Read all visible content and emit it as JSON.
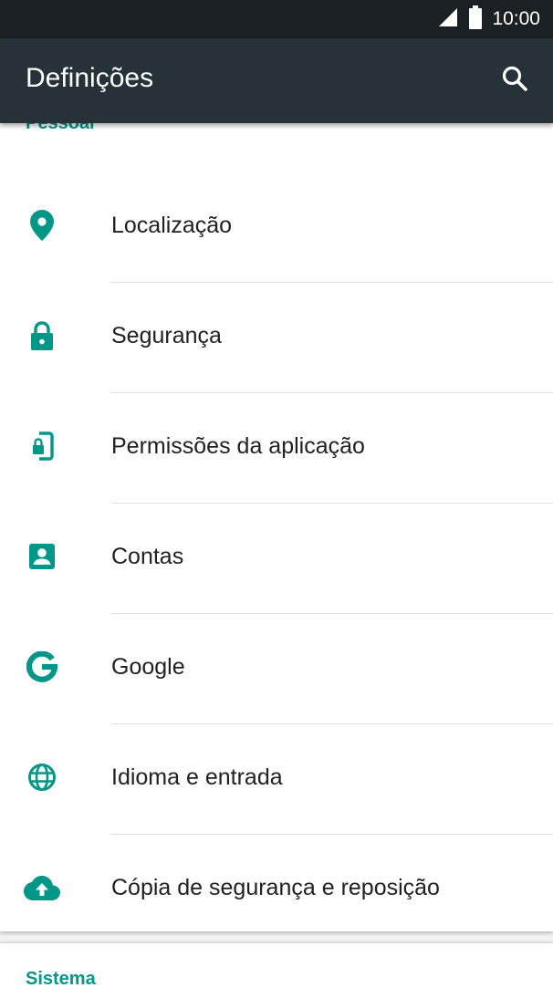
{
  "status_bar": {
    "time": "10:00",
    "icons": [
      "signal-icon",
      "battery-icon"
    ]
  },
  "app_bar": {
    "title": "Definições",
    "search_icon": "search-icon"
  },
  "sections": [
    {
      "header": "Pessoal",
      "items": [
        {
          "label": "Localização",
          "icon": "location-pin-icon"
        },
        {
          "label": "Segurança",
          "icon": "lock-icon"
        },
        {
          "label": "Permissões da aplicação",
          "icon": "app-permissions-icon"
        },
        {
          "label": "Contas",
          "icon": "account-box-icon"
        },
        {
          "label": "Google",
          "icon": "google-icon"
        },
        {
          "label": "Idioma e entrada",
          "icon": "globe-icon"
        },
        {
          "label": "Cópia de segurança e reposição",
          "icon": "cloud-upload-icon"
        }
      ]
    },
    {
      "header": "Sistema",
      "items": []
    }
  ],
  "colors": {
    "status_bar": "#1b2024",
    "app_bar": "#263238",
    "accent": "#009688",
    "text_primary": "#212121",
    "background": "#f2f2f2",
    "divider": "#e0e0e0"
  }
}
